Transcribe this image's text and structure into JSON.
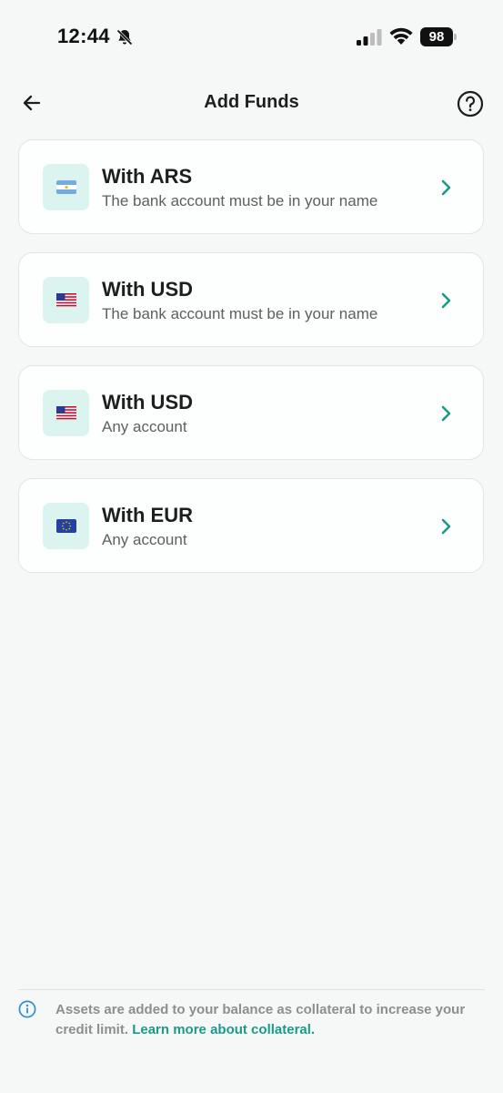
{
  "status_bar": {
    "time": "12:44",
    "battery": "98",
    "icons": [
      "bell-muted-icon",
      "signal-icon",
      "wifi-icon",
      "battery-icon"
    ]
  },
  "header": {
    "title": "Add Funds",
    "back_icon": "arrow-left-icon",
    "help_icon": "question-circle-icon"
  },
  "options": [
    {
      "flag": "argentina-flag-icon",
      "title": "With ARS",
      "subtitle": "The bank account must be in your name"
    },
    {
      "flag": "usa-flag-icon",
      "title": "With USD",
      "subtitle": "The bank account must be in your name"
    },
    {
      "flag": "usa-flag-icon",
      "title": "With USD",
      "subtitle": "Any account"
    },
    {
      "flag": "eu-flag-icon",
      "title": "With EUR",
      "subtitle": "Any account"
    }
  ],
  "footer": {
    "text": "Assets are added to your balance as collateral to increase your credit limit.",
    "link": "Learn more about collateral."
  },
  "colors": {
    "accent": "#1a9a8a",
    "tile_background": "#dcf4ef",
    "page_background": "#f6f7f7"
  }
}
